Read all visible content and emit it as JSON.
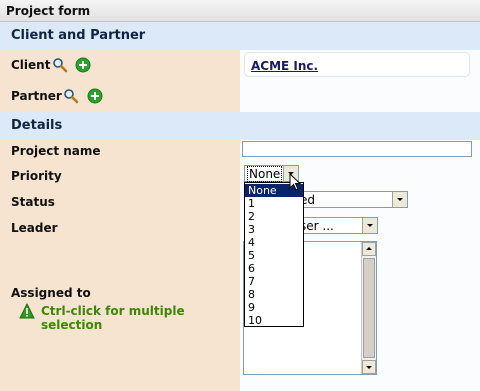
{
  "window": {
    "title": "Project form"
  },
  "sections": {
    "client_partner": {
      "title": "Client and Partner"
    },
    "details": {
      "title": "Details"
    }
  },
  "client": {
    "label": "Client",
    "value": "ACME Inc."
  },
  "partner": {
    "label": "Partner"
  },
  "project_name": {
    "label": "Project name",
    "value": ""
  },
  "priority": {
    "label": "Priority",
    "selected": "None",
    "options": [
      "None",
      "1",
      "2",
      "3",
      "4",
      "5",
      "6",
      "7",
      "8",
      "9",
      "10"
    ]
  },
  "status": {
    "label": "Status",
    "value_fragment": "ed"
  },
  "leader": {
    "label": "Leader",
    "value_fragment": "ser ..."
  },
  "assigned_to": {
    "label": "Assigned to",
    "hint_line1": "Ctrl-click for multiple",
    "hint_line2": "selection"
  },
  "colors": {
    "section_header_bg": "#dce9f8",
    "label_column_bg": "#f6e3d0",
    "hint_green": "#3a8a00",
    "selected_option_bg": "#0a246a"
  },
  "icons": {
    "search": "magnifier-icon",
    "add": "green-plus-icon",
    "warning": "warning-icon"
  }
}
